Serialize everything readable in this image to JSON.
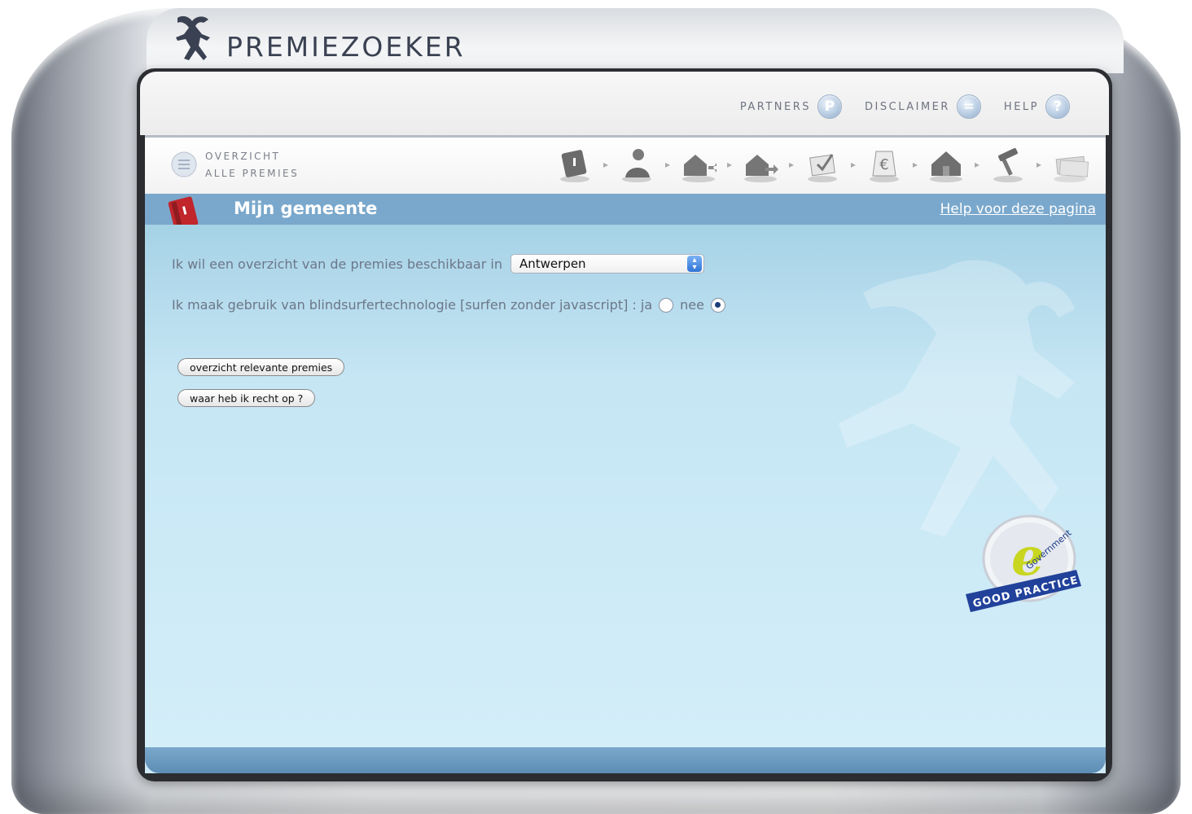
{
  "app": {
    "brand": "PREMIEZOEKER"
  },
  "topnav": {
    "items": [
      {
        "label": "PARTNERS",
        "icon": "P"
      },
      {
        "label": "DISCLAIMER",
        "icon": "="
      },
      {
        "label": "HELP",
        "icon": "?"
      }
    ]
  },
  "subnav": {
    "overview_line1": "OVERZICHT",
    "overview_line2": "ALLE PREMIES",
    "steps": [
      "book-step-icon",
      "person-step-icon",
      "house-arrow-in-step-icon",
      "house-arrow-out-step-icon",
      "checklist-step-icon",
      "euro-step-icon",
      "house-step-icon",
      "hammer-step-icon",
      "money-step-icon"
    ]
  },
  "section": {
    "title": "Mijn gemeente",
    "help_link": "Help voor deze pagina"
  },
  "form": {
    "municipality_label": "Ik wil een overzicht van de premies beschikbaar in",
    "municipality_value": "Antwerpen",
    "blind_label": "Ik maak gebruik van blindsurfertechnologie [surfen zonder javascript] : ja",
    "option_yes": "ja",
    "option_no": "nee",
    "selected": "nee"
  },
  "buttons": {
    "overview": "overzicht relevante premies",
    "rights": "waar heb ik recht op ?"
  },
  "badge": {
    "letter": "e",
    "arc_text": "Government",
    "ribbon_text": "GOOD PRACTICE"
  },
  "colors": {
    "accent_blue": "#7aa8cc",
    "panel_bg": "#cfeaf6",
    "text_grey": "#6c7788"
  }
}
